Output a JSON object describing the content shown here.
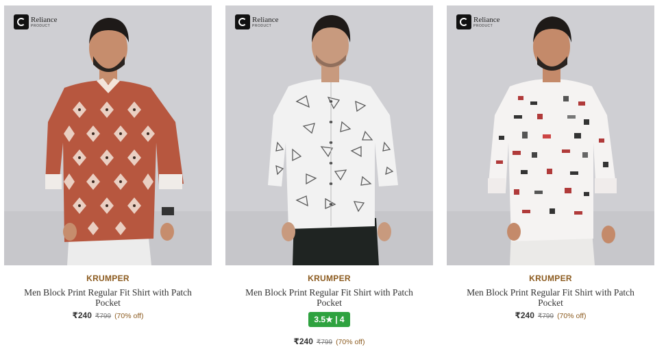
{
  "logo": {
    "name": "Reliance",
    "sub": "PRODUCT"
  },
  "products": [
    {
      "brand": "KRUMPER",
      "title": "Men Block Print Regular Fit Shirt with Patch Pocket",
      "price": "₹240",
      "mrp": "₹799",
      "discount": "(70% off)",
      "shirt_color": "#b7573f",
      "bg_color": "#cfcfd3"
    },
    {
      "brand": "KRUMPER",
      "title": "Men Block Print Regular Fit Shirt with Patch Pocket",
      "rating": "3.5★ | 4",
      "price": "₹240",
      "mrp": "₹799",
      "discount": "(70% off)",
      "shirt_color": "#f2f2f2",
      "bg_color": "#cfcfd3"
    },
    {
      "brand": "KRUMPER",
      "title": "Men Block Print Regular Fit Shirt with Patch Pocket",
      "price": "₹240",
      "mrp": "₹799",
      "discount": "(70% off)",
      "shirt_color": "#f5f3f2",
      "bg_color": "#cfcfd3"
    }
  ],
  "colors": {
    "brand_text": "#8b5a1e",
    "rating_badge": "#2ea23f"
  }
}
